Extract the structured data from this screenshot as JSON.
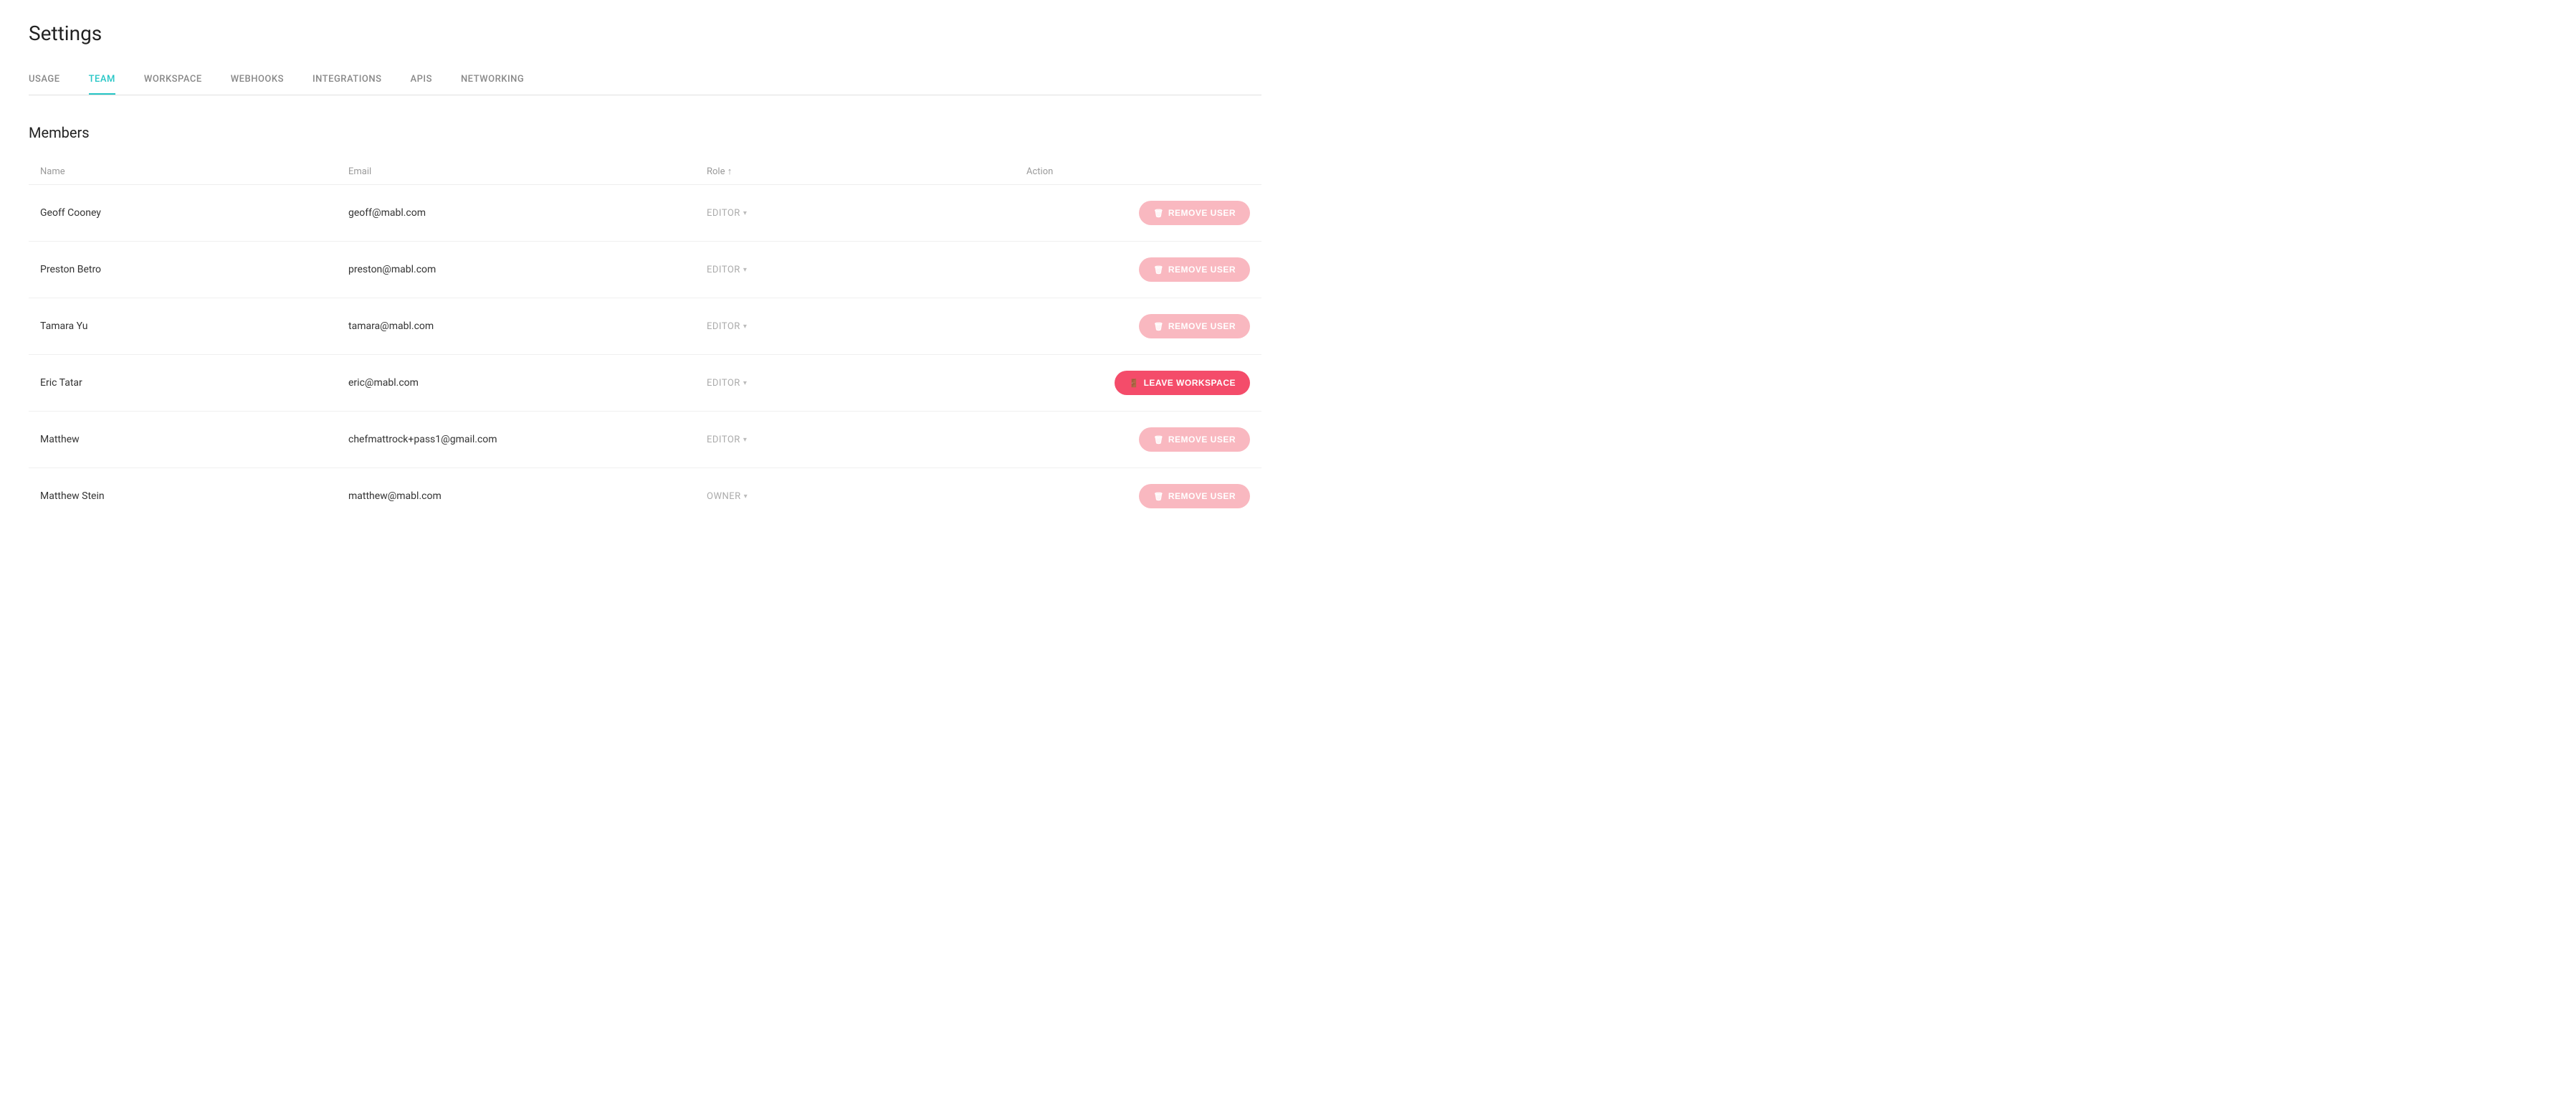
{
  "page": {
    "title": "Settings"
  },
  "tabs": [
    {
      "id": "usage",
      "label": "USAGE",
      "active": false
    },
    {
      "id": "team",
      "label": "TEAM",
      "active": true
    },
    {
      "id": "workspace",
      "label": "WORKSPACE",
      "active": false
    },
    {
      "id": "webhooks",
      "label": "WEBHOOKS",
      "active": false
    },
    {
      "id": "integrations",
      "label": "INTEGRATIONS",
      "active": false
    },
    {
      "id": "apis",
      "label": "APIS",
      "active": false
    },
    {
      "id": "networking",
      "label": "NETWORKING",
      "active": false
    }
  ],
  "members_section": {
    "title": "Members",
    "columns": {
      "name": "Name",
      "email": "Email",
      "role": "Role ↑",
      "action": "Action"
    },
    "members": [
      {
        "id": 1,
        "name": "Geoff Cooney",
        "email": "geoff@mabl.com",
        "role": "EDITOR",
        "action": "REMOVE USER",
        "is_current_user": false
      },
      {
        "id": 2,
        "name": "Preston Betro",
        "email": "preston@mabl.com",
        "role": "EDITOR",
        "action": "REMOVE USER",
        "is_current_user": false
      },
      {
        "id": 3,
        "name": "Tamara Yu",
        "email": "tamara@mabl.com",
        "role": "EDITOR",
        "action": "REMOVE USER",
        "is_current_user": false
      },
      {
        "id": 4,
        "name": "Eric Tatar",
        "email": "eric@mabl.com",
        "role": "EDITOR",
        "action": "LEAVE WORKSPACE",
        "is_current_user": true
      },
      {
        "id": 5,
        "name": "Matthew",
        "email": "chefmattrock+pass1@gmail.com",
        "role": "EDITOR",
        "action": "REMOVE USER",
        "is_current_user": false
      },
      {
        "id": 6,
        "name": "Matthew Stein",
        "email": "matthew@mabl.com",
        "role": "OWNER",
        "action": "REMOVE USER",
        "is_current_user": false
      }
    ]
  },
  "icons": {
    "trash": "🗑",
    "leave": "→",
    "chevron": "▾"
  }
}
